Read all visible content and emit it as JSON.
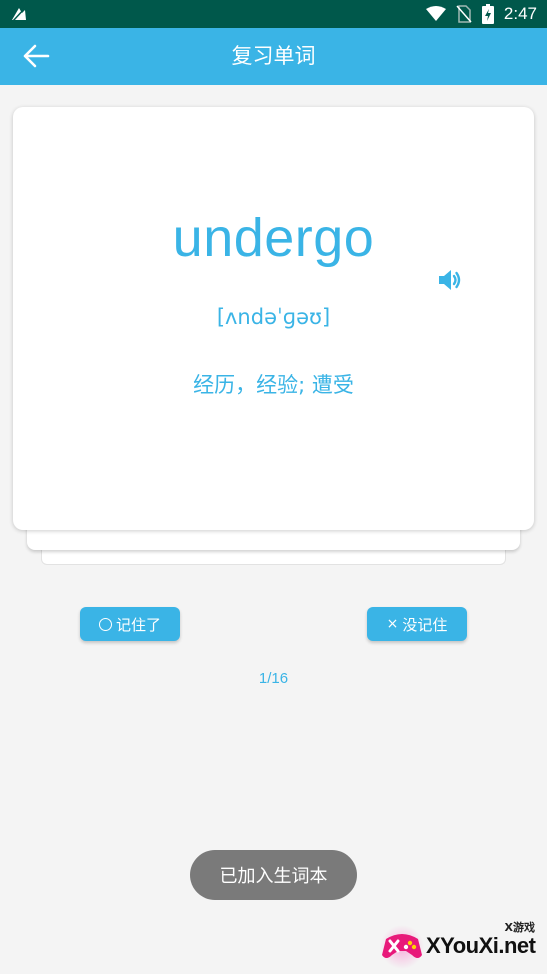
{
  "status_bar": {
    "time": "2:47",
    "left_icon": "notification-app-icon",
    "icons": [
      "wifi-icon",
      "no-sim-icon",
      "battery-icon"
    ]
  },
  "app_bar": {
    "title": "复习单词",
    "back_icon": "arrow-left-icon"
  },
  "card": {
    "word": "undergo",
    "phonetic": "[ʌndəˈɡəʊ]",
    "definition": "经历，经验; 遭受",
    "speaker_icon": "speaker-icon"
  },
  "actions": {
    "remembered_label": "记住了",
    "forgot_label": "没记住",
    "forgot_glyph": "×"
  },
  "progress": {
    "text": "1/16",
    "current": 1,
    "total": 16
  },
  "toast": {
    "message": "已加入生词本"
  },
  "watermark": {
    "small_text": "X游戏",
    "brand": "XYouXi.net"
  },
  "colors": {
    "accent": "#3ab4e6",
    "status_bar": "#00584b",
    "toast": "#7a7a7a",
    "background": "#f4f4f4"
  }
}
